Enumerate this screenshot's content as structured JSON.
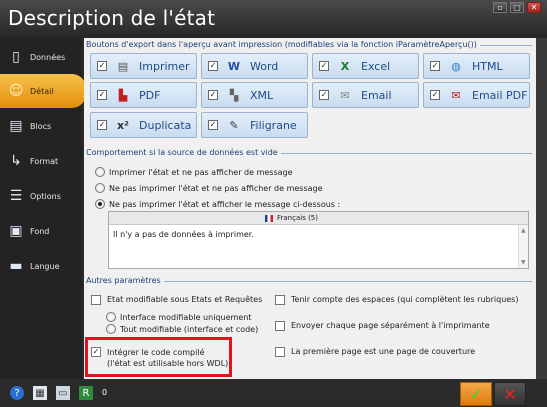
{
  "window": {
    "title": "Description de l'état",
    "controls": [
      "▫",
      "□",
      "✕"
    ]
  },
  "sidebar": {
    "items": [
      {
        "label": "Données",
        "icon": "document-icon",
        "glyph": "▯"
      },
      {
        "label": "Détail",
        "icon": "smiley-icon",
        "glyph": "☺"
      },
      {
        "label": "Blocs",
        "icon": "blocks-icon",
        "glyph": "▤"
      },
      {
        "label": "Format",
        "icon": "format-icon",
        "glyph": "↳"
      },
      {
        "label": "Options",
        "icon": "options-icon",
        "glyph": "☰"
      },
      {
        "label": "Fond",
        "icon": "background-icon",
        "glyph": "▣"
      },
      {
        "label": "Langue",
        "icon": "book-icon",
        "glyph": "▬"
      }
    ]
  },
  "export_section": {
    "title": "Boutons d'export dans l'aperçu avant impression (modifiables via la fonction iParamètreAperçu())",
    "buttons": [
      {
        "label": "Imprimer",
        "icon": "printer-icon",
        "glyph": "▤",
        "color": "#555555",
        "checked": true
      },
      {
        "label": "Word",
        "icon": "word-icon",
        "glyph": "W",
        "color": "#1f4fa0",
        "checked": true
      },
      {
        "label": "Excel",
        "icon": "excel-icon",
        "glyph": "X",
        "color": "#1e7a2e",
        "checked": true
      },
      {
        "label": "HTML",
        "icon": "globe-icon",
        "glyph": "◍",
        "color": "#2a7fd0",
        "checked": true
      },
      {
        "label": "PDF",
        "icon": "pdf-icon",
        "glyph": "▙",
        "color": "#c0201d",
        "checked": true
      },
      {
        "label": "XML",
        "icon": "xml-icon",
        "glyph": "▚",
        "color": "#666666",
        "checked": true
      },
      {
        "label": "Email",
        "icon": "email-icon",
        "glyph": "✉",
        "color": "#888888",
        "checked": true
      },
      {
        "label": "Email PDF",
        "icon": "email-pdf-icon",
        "glyph": "✉",
        "color": "#c0201d",
        "checked": true
      },
      {
        "label": "Duplicata",
        "icon": "duplicate-icon",
        "glyph": "x²",
        "color": "#333333",
        "checked": true
      },
      {
        "label": "Filigrane",
        "icon": "watermark-icon",
        "glyph": "✎",
        "color": "#333333",
        "checked": true
      }
    ]
  },
  "empty_source_section": {
    "title": "Comportement si la source de données est vide",
    "options": [
      {
        "label": "Imprimer l'état et ne pas afficher de message",
        "selected": false
      },
      {
        "label": "Ne pas imprimer l'état et ne pas afficher de message",
        "selected": false
      },
      {
        "label": "Ne pas imprimer l'état et afficher le message ci-dessous :",
        "selected": true
      }
    ],
    "language": "Français (5)",
    "message": "Il n'y a pas de données à imprimer."
  },
  "other_params_section": {
    "title": "Autres paramètres",
    "left": {
      "etat_modifiable": "Etat modifiable sous Etats et Requêtes",
      "interface_modifiable": "Interface modifiable uniquement",
      "tout_modifiable": "Tout modifiable (interface et code)",
      "integrer_code_line1": "Intégrer le code compilé",
      "integrer_code_line2": "(l'état est utilisable hors WDL)"
    },
    "right": {
      "tenir_compte": "Tenir compte des espaces (qui complètent les rubriques)",
      "envoyer_page": "Envoyer chaque page séparément à l'imprimante",
      "premiere_page": "La première page est une page de couverture"
    }
  },
  "bottom_bar": {
    "count": "0",
    "ok_glyph": "✓",
    "cancel_glyph": "✕"
  }
}
